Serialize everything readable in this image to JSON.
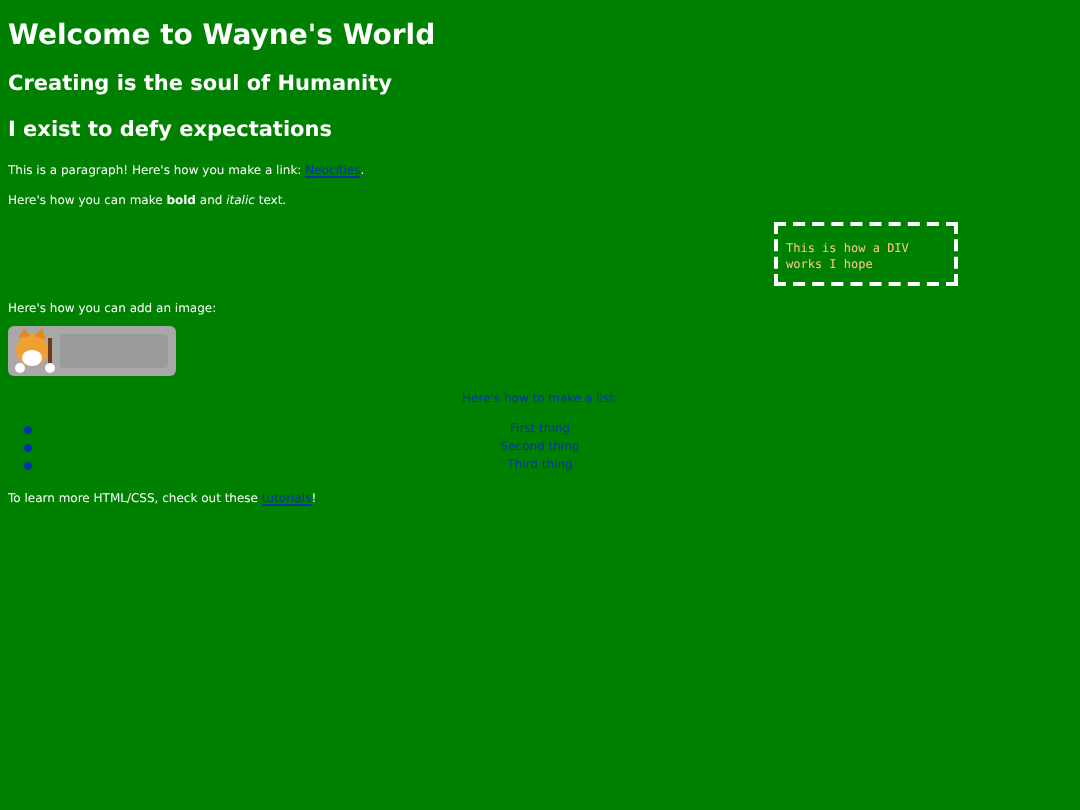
{
  "title": "Welcome to Wayne's World",
  "subtitles": [
    "Creating is the soul of Humanity",
    "I exist to defy expectations"
  ],
  "link_paragraph": {
    "before": "This is a paragraph! Here's how you make a link: ",
    "link": "Neocities",
    "after": "."
  },
  "format_paragraph": "Here's how you can make **bold** and *italic* text.",
  "div_box": {
    "text": "This is how a DIV works I hope"
  },
  "image_caption": "Here's how you can add an image:",
  "image": {
    "kind": "picture"
  },
  "list": {
    "heading": "Here's how to make a list:",
    "items": [
      "First thing",
      "Second thing",
      "Third thing"
    ]
  },
  "footer": {
    "before": "To learn more HTML/CSS, check out these ",
    "link": "tutorials",
    "after": "!"
  }
}
